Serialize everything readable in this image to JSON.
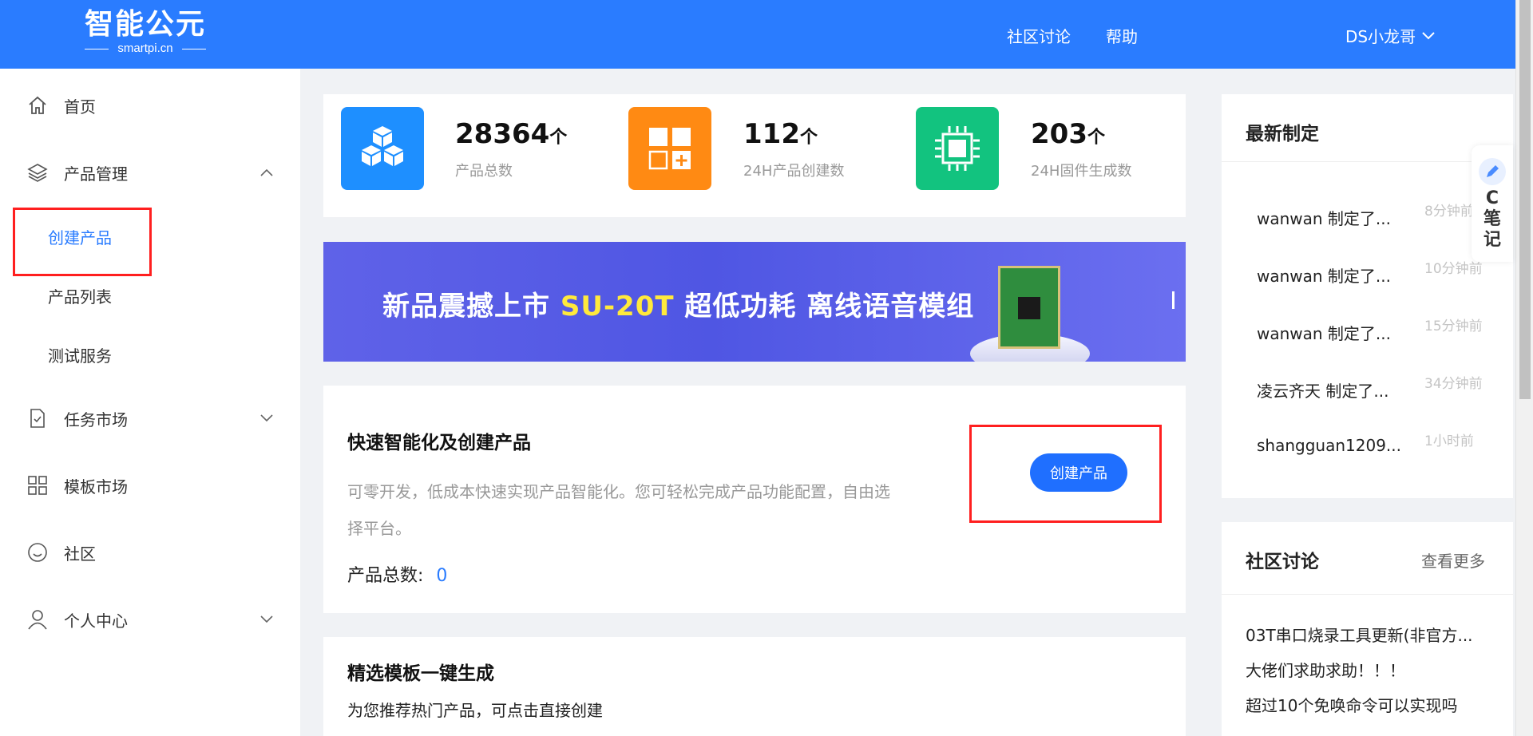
{
  "header": {
    "logo_main": "智能公元",
    "logo_sub": "smartpi.cn",
    "nav": [
      "社区讨论",
      "帮助"
    ],
    "user": "DS小龙哥"
  },
  "sidebar": {
    "home": "首页",
    "product_mgmt": "产品管理",
    "sub_items": [
      "创建产品",
      "产品列表",
      "测试服务"
    ],
    "task_market": "任务市场",
    "template_market": "模板市场",
    "community": "社区",
    "personal": "个人中心"
  },
  "stats": [
    {
      "value": "28364",
      "unit": "个",
      "label": "产品总数",
      "color": "#1e8fff"
    },
    {
      "value": "112",
      "unit": "个",
      "label": "24H产品创建数",
      "color": "#ff8a13"
    },
    {
      "value": "203",
      "unit": "个",
      "label": "24H固件生成数",
      "color": "#12c37f"
    }
  ],
  "banner": {
    "prefix": "新品震撼上市 ",
    "highlight": "SU-20T",
    "suffix": "  超低功耗  离线语音模组"
  },
  "quick": {
    "title": "快速智能化及创建产品",
    "desc": "可零开发，低成本快速实现产品智能化。您可轻松完成产品功能配置，自由选择平台。",
    "count_label": "产品总数:",
    "count_value": "0",
    "button": "创建产品"
  },
  "templates": {
    "title": "精选模板一键生成",
    "desc": "为您推荐热门产品，可点击直接创建"
  },
  "latest": {
    "title": "最新制定",
    "items": [
      {
        "text": "wanwan 制定了...",
        "time": "8分钟前"
      },
      {
        "text": "wanwan 制定了...",
        "time": "10分钟前"
      },
      {
        "text": "wanwan 制定了...",
        "time": "15分钟前"
      },
      {
        "text": "凌云齐天 制定了...",
        "time": "34分钟前"
      },
      {
        "text": "shangguan1209...",
        "time": "1小时前"
      }
    ]
  },
  "discussion": {
    "title": "社区讨论",
    "more": "查看更多",
    "items": [
      "03T串口烧录工具更新(非官方...",
      "大佬们求助求助！！！",
      "超过10个免唤命令可以实现吗"
    ]
  },
  "note_tab": {
    "letter": "C",
    "chars": [
      "笔",
      "记"
    ]
  }
}
